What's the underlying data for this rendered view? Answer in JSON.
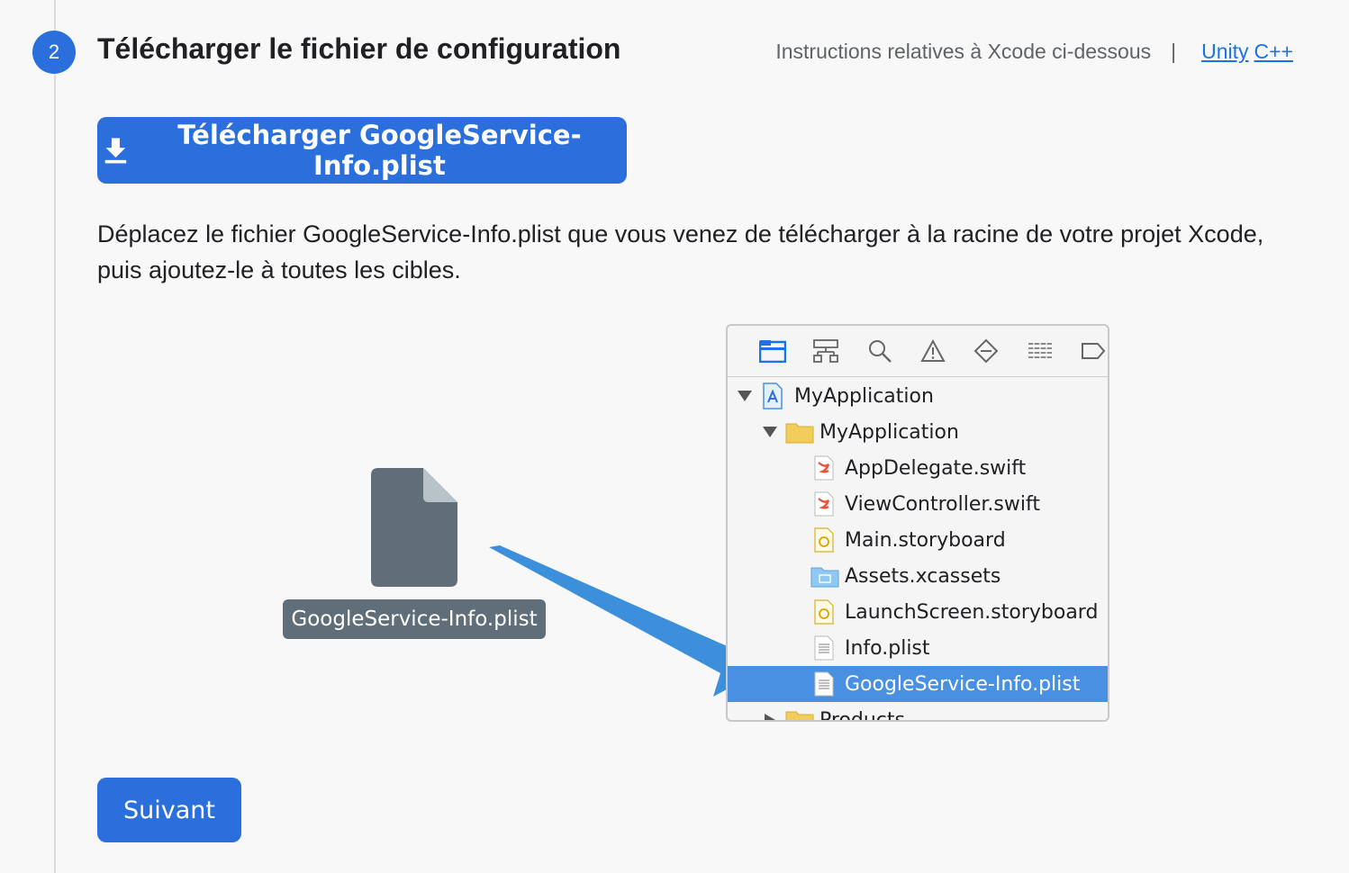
{
  "step": {
    "number": "2",
    "title": "Télécharger le fichier de configuration"
  },
  "header": {
    "instructions": "Instructions relatives à Xcode ci-dessous",
    "separator": "|",
    "links": [
      "Unity",
      "C++"
    ]
  },
  "download_button": {
    "label": "Télécharger GoogleService-Info.plist",
    "icon": "download-icon"
  },
  "description": "Déplacez le fichier GoogleService-Info.plist que vous venez de télécharger à la racine de votre projet Xcode, puis ajoutez-le à toutes les cibles.",
  "dragged_file": {
    "label": "GoogleService-Info.plist",
    "icon": "document-icon"
  },
  "xcode_navigator": {
    "toolbar_icons": [
      "folder-icon",
      "hierarchy-icon",
      "search-icon",
      "warning-icon",
      "breakpoint-icon",
      "list-icon",
      "tag-icon"
    ],
    "items": [
      {
        "label": "MyApplication",
        "icon": "xcode-project-icon",
        "expanded": true
      },
      {
        "label": "MyApplication",
        "icon": "folder-icon",
        "expanded": true
      },
      {
        "label": "AppDelegate.swift",
        "icon": "swift-file-icon"
      },
      {
        "label": "ViewController.swift",
        "icon": "swift-file-icon"
      },
      {
        "label": "Main.storyboard",
        "icon": "storyboard-icon"
      },
      {
        "label": "Assets.xcassets",
        "icon": "assets-folder-icon"
      },
      {
        "label": "LaunchScreen.storyboard",
        "icon": "storyboard-icon"
      },
      {
        "label": "Info.plist",
        "icon": "plist-icon"
      },
      {
        "label": "GoogleService-Info.plist",
        "icon": "plist-icon",
        "selected": true
      },
      {
        "label": "Products",
        "icon": "folder-icon",
        "expanded": false
      }
    ]
  },
  "next_button": {
    "label": "Suivant"
  },
  "colors": {
    "primary": "#2a6fdb",
    "link": "#1a73e8",
    "selection": "#4a90e2",
    "arrow": "#3b8fdb"
  }
}
